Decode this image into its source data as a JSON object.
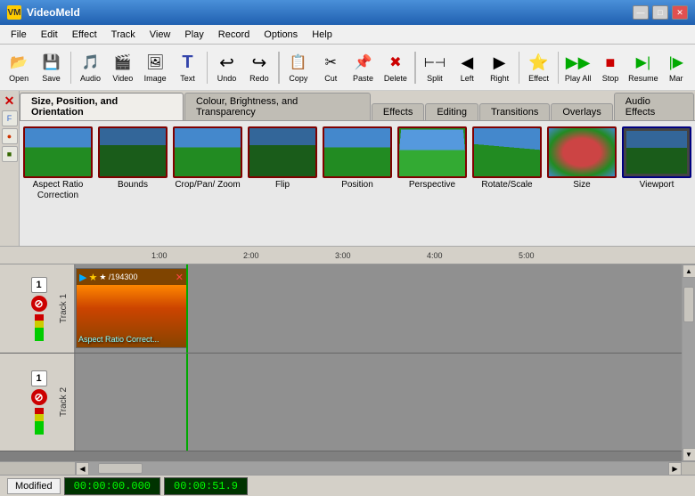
{
  "app": {
    "title": "VideoMeld",
    "icon": "VM"
  },
  "titlebar": {
    "minimize": "—",
    "maximize": "□",
    "close": "✕"
  },
  "menu": {
    "items": [
      "File",
      "Edit",
      "Effect",
      "Track",
      "View",
      "Play",
      "Record",
      "Options",
      "Help"
    ]
  },
  "toolbar": {
    "buttons": [
      {
        "name": "open-button",
        "label": "Open",
        "icon": "📂"
      },
      {
        "name": "save-button",
        "label": "Save",
        "icon": "💾"
      },
      {
        "name": "audio-button",
        "label": "Audio",
        "icon": "🎵"
      },
      {
        "name": "video-button",
        "label": "Video",
        "icon": "📹"
      },
      {
        "name": "image-button",
        "label": "Image",
        "icon": "🖼"
      },
      {
        "name": "text-button",
        "label": "Text",
        "icon": "T"
      },
      {
        "name": "undo-button",
        "label": "Undo",
        "icon": "↩"
      },
      {
        "name": "redo-button",
        "label": "Redo",
        "icon": "↪"
      },
      {
        "name": "copy-button",
        "label": "Copy",
        "icon": "📋"
      },
      {
        "name": "cut-button",
        "label": "Cut",
        "icon": "✂"
      },
      {
        "name": "paste-button",
        "label": "Paste",
        "icon": "📌"
      },
      {
        "name": "delete-button",
        "label": "Delete",
        "icon": "✖"
      },
      {
        "name": "split-button",
        "label": "Split",
        "icon": "⊣"
      },
      {
        "name": "left-button",
        "label": "Left",
        "icon": "◀"
      },
      {
        "name": "right-button",
        "label": "Right",
        "icon": "▶"
      },
      {
        "name": "effect-button",
        "label": "Effect",
        "icon": "⭐"
      },
      {
        "name": "play-all-button",
        "label": "Play All",
        "icon": "▶▶"
      },
      {
        "name": "stop-button",
        "label": "Stop",
        "icon": "■"
      },
      {
        "name": "resume-button",
        "label": "Resume",
        "icon": "▶|"
      },
      {
        "name": "mar-button",
        "label": "Mar",
        "icon": "|▶"
      }
    ]
  },
  "tabs": {
    "items": [
      {
        "name": "tab-size-position",
        "label": "Size, Position, and Orientation",
        "active": true
      },
      {
        "name": "tab-colour",
        "label": "Colour, Brightness, and Transparency",
        "active": false
      },
      {
        "name": "tab-effects",
        "label": "Effects",
        "active": false
      },
      {
        "name": "tab-editing",
        "label": "Editing",
        "active": false
      },
      {
        "name": "tab-transitions",
        "label": "Transitions",
        "active": false
      },
      {
        "name": "tab-overlays",
        "label": "Overlays",
        "active": false
      },
      {
        "name": "tab-audio-effects",
        "label": "Audio Effects",
        "active": false
      }
    ]
  },
  "effects": {
    "items": [
      {
        "name": "effect-aspect-ratio",
        "label": "Aspect Ratio\nCorrection",
        "type": "palm"
      },
      {
        "name": "effect-bounds",
        "label": "Bounds",
        "type": "palm-dark"
      },
      {
        "name": "effect-crop-pan",
        "label": "Crop/Pan/\nZoom",
        "type": "palm"
      },
      {
        "name": "effect-flip",
        "label": "Flip",
        "type": "palm-dark"
      },
      {
        "name": "effect-position",
        "label": "Position",
        "type": "palm"
      },
      {
        "name": "effect-perspective",
        "label": "Perspective",
        "type": "palm-perspective"
      },
      {
        "name": "effect-rotate-scale",
        "label": "Rotate/Scale",
        "type": "palm-rotate"
      },
      {
        "name": "effect-size",
        "label": "Size",
        "type": "palm-dish"
      },
      {
        "name": "effect-viewport",
        "label": "Viewport",
        "type": "palm-viewport",
        "selected": true
      }
    ]
  },
  "timeline": {
    "ruler_marks": [
      "1:00",
      "2:00",
      "3:00",
      "4:00",
      "5:00"
    ],
    "tracks": [
      {
        "name": "track-1",
        "label": "Track 1",
        "num": "1",
        "clip": {
          "name": "clip-1",
          "header": "★ /194300",
          "label": "Aspect Ratio Correct..."
        }
      },
      {
        "name": "track-2",
        "label": "Track 2",
        "num": "1",
        "clip": null
      }
    ]
  },
  "status": {
    "modified_label": "Modified",
    "time": "00:00:00.000",
    "duration": "00:00:51.9"
  }
}
